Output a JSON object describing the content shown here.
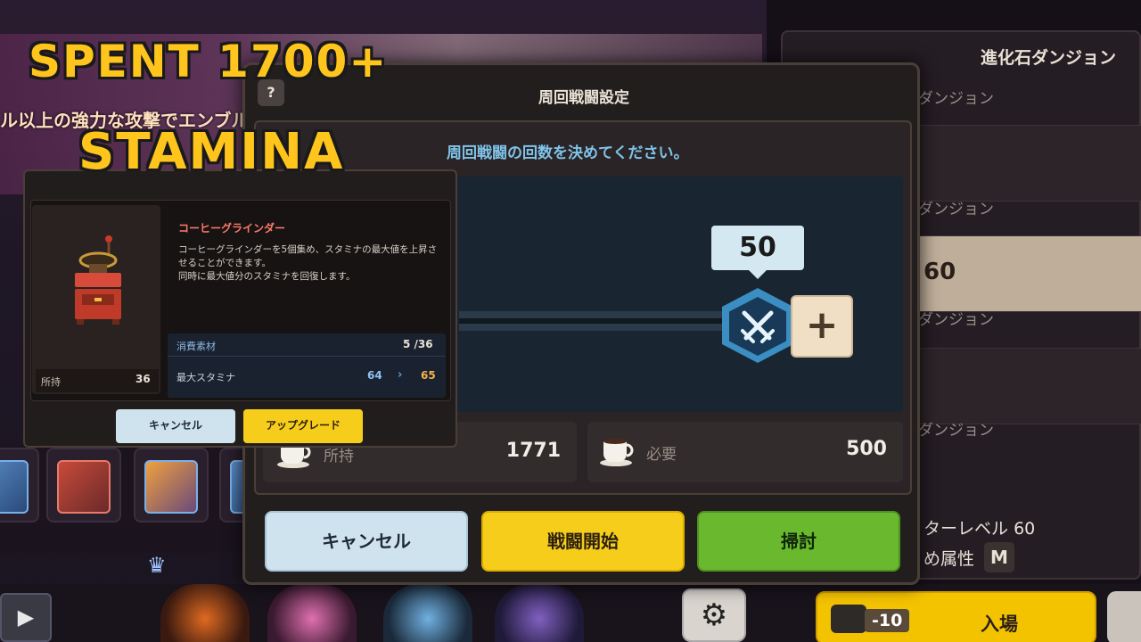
{
  "overlay": {
    "line1": "SPENT 1700+",
    "line2": "STAMINA"
  },
  "background": {
    "banner_text": "ル以上の強力な攻撃でエンブル獲得する"
  },
  "right_panel": {
    "title": "進化石ダンジョン",
    "rows": [
      "ダンジョン",
      "ダンジョン",
      "ダンジョン",
      "ダンジョン"
    ],
    "selected_value": "60",
    "level_label": "ターレベル",
    "level_value": "60",
    "attribute_label": "め属性",
    "attribute_icon": "M",
    "enter": {
      "cost": "-10",
      "label": "入場"
    }
  },
  "dialog": {
    "help": "?",
    "title": "周回戦闘設定",
    "instruction": "周回戦闘の回数を決めてください。",
    "count": "50",
    "plus": "+",
    "own_label": "所持",
    "own_value": "1771",
    "need_label": "必要",
    "need_value": "500",
    "buttons": {
      "cancel": "キャンセル",
      "start": "戦闘開始",
      "sweep": "掃討"
    }
  },
  "upgrade": {
    "item_name": "コーヒーグラインダー",
    "description": "コーヒーグラインダーを5個集め、スタミナの最大値を上昇させることができます。\n同時に最大値分のスタミナを回復します。",
    "own_label": "所持",
    "own_value": "36",
    "material_label": "消費素材",
    "material_value": "5 /36",
    "stamina_label": "最大スタミナ",
    "stamina_from": "64",
    "stamina_to": "65",
    "arrow": "›",
    "buttons": {
      "cancel": "キャンセル",
      "upgrade": "アップグレード"
    }
  },
  "icons": {
    "play": "play-icon",
    "gear": "gear-icon",
    "crown": "crown-icon",
    "swords": "crossed-swords-icon",
    "cup": "coffee-cup-icon",
    "grinder": "coffee-grinder-icon"
  },
  "colors": {
    "caption": "#ffc51c",
    "start_button": "#f6cd1a",
    "sweep_button": "#6ab82e",
    "cancel_button": "#cfe3ee",
    "instruction": "#7fc4ea",
    "item_name": "#ff7a6a"
  }
}
